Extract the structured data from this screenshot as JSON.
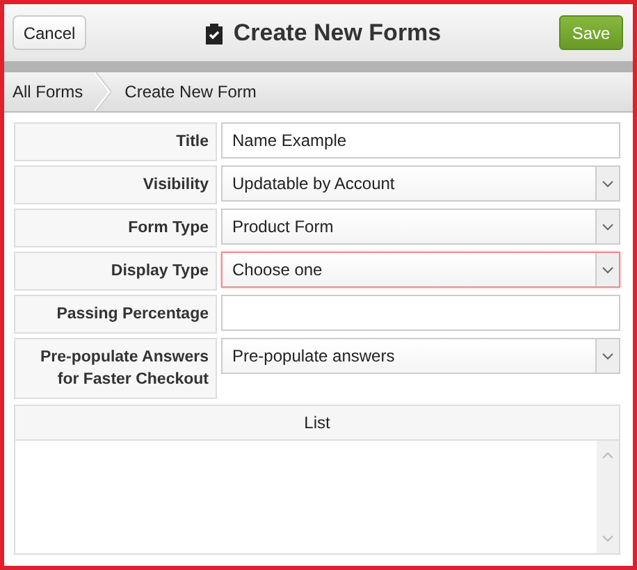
{
  "header": {
    "cancel": "Cancel",
    "title": "Create New Forms",
    "save": "Save"
  },
  "breadcrumbs": [
    {
      "label": "All Forms"
    },
    {
      "label": "Create New Form"
    }
  ],
  "fields": [
    {
      "label": "Title",
      "kind": "text",
      "value": "Name Example",
      "invalid": false
    },
    {
      "label": "Visibility",
      "kind": "select",
      "value": "Updatable by Account",
      "invalid": false
    },
    {
      "label": "Form Type",
      "kind": "select",
      "value": "Product Form",
      "invalid": false
    },
    {
      "label": "Display Type",
      "kind": "select",
      "value": "Choose one",
      "invalid": true
    },
    {
      "label": "Passing Percentage",
      "kind": "text",
      "invalid": false
    },
    {
      "label": "Pre-populate Answers for Faster Checkout",
      "kind": "select",
      "value": "Pre-populate answers",
      "invalid": false
    }
  ],
  "list": {
    "title": "List"
  }
}
